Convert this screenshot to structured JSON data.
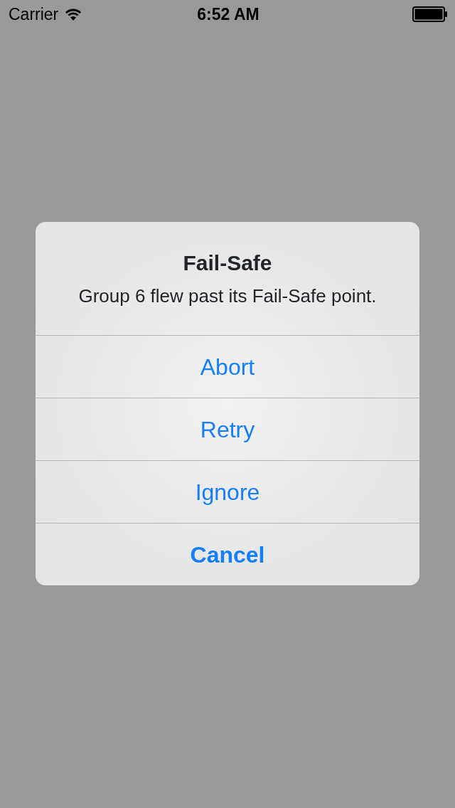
{
  "status_bar": {
    "carrier": "Carrier",
    "time": "6:52 AM"
  },
  "alert": {
    "title": "Fail-Safe",
    "message": "Group 6 flew past its Fail-Safe point.",
    "buttons": [
      {
        "label": "Abort",
        "kind": "default"
      },
      {
        "label": "Retry",
        "kind": "default"
      },
      {
        "label": "Ignore",
        "kind": "default"
      },
      {
        "label": "Cancel",
        "kind": "cancel"
      }
    ]
  }
}
